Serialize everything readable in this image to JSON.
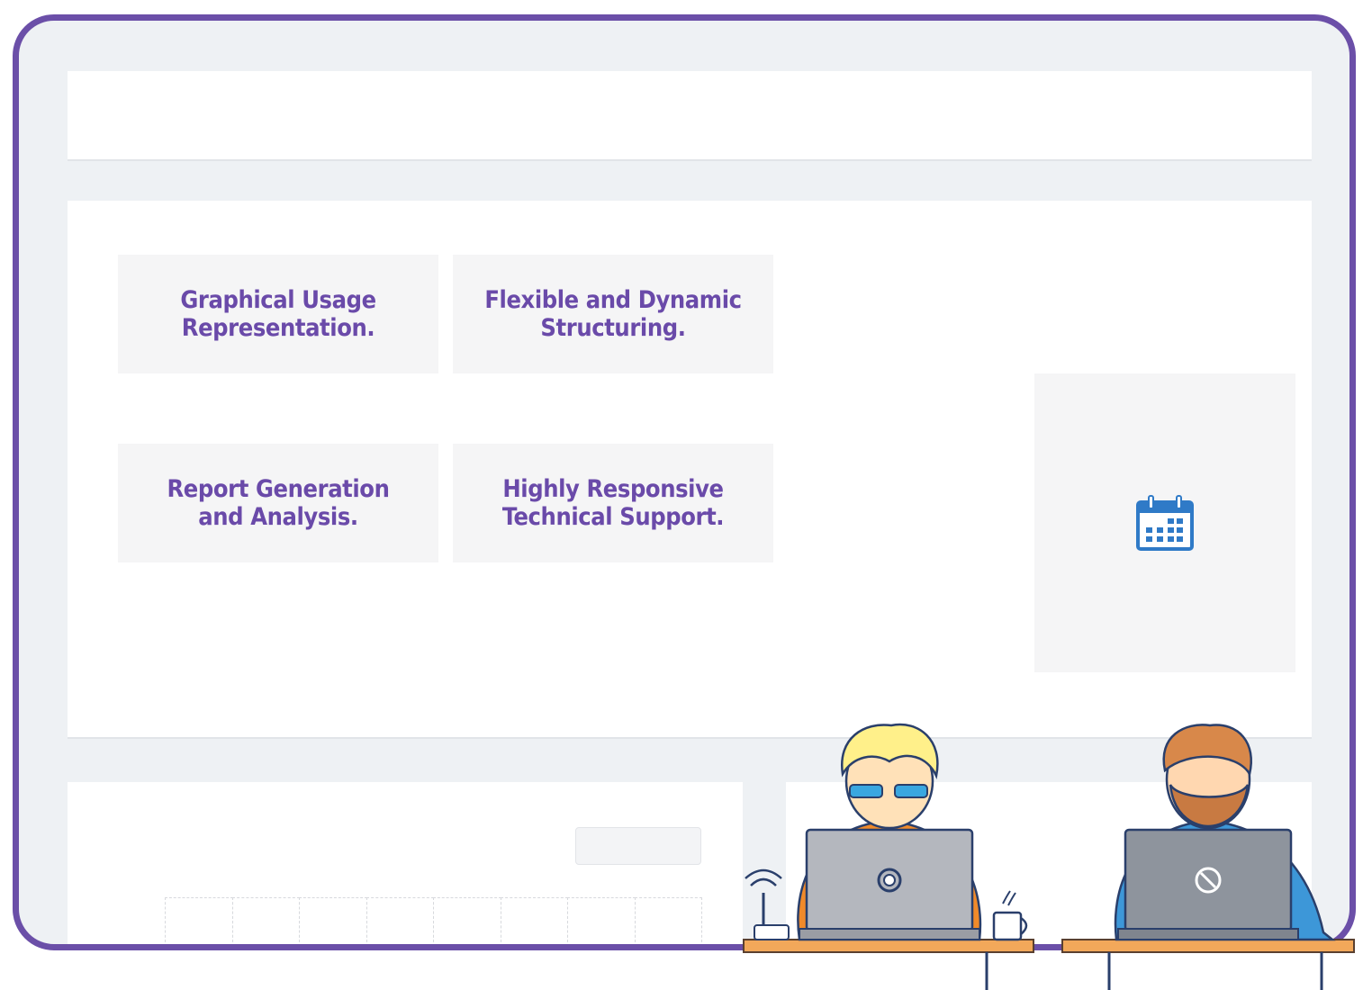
{
  "features": [
    {
      "label": "Graphical Usage\nRepresentation."
    },
    {
      "label": "Flexible and Dynamic\nStructuring."
    },
    {
      "label": "Report Generation\nand Analysis."
    },
    {
      "label": "Highly Responsive\nTechnical Support."
    }
  ],
  "icons": {
    "calendar": "calendar-icon",
    "wifi": "wifi-router-icon",
    "laptop_left_logo": "power-circle-icon",
    "laptop_right_logo": "blocked-circle-icon",
    "mug": "coffee-mug-icon"
  },
  "colors": {
    "frame": "#6b4fa8",
    "feature_text": "#6a4aa9",
    "calendar": "#2f7ac7",
    "background": "#eef1f4"
  }
}
